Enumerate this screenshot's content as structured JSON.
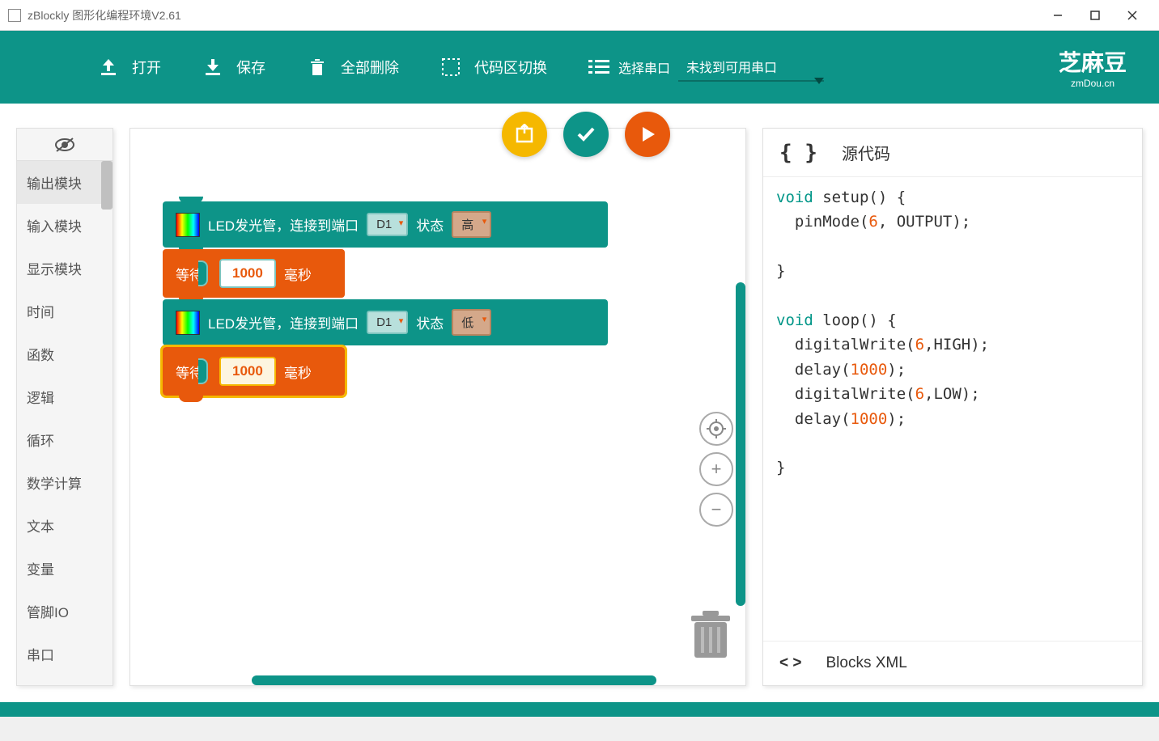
{
  "window": {
    "title": "zBlockly 图形化编程环境V2.61"
  },
  "toolbar": {
    "open": "打开",
    "save": "保存",
    "deleteAll": "全部删除",
    "toggleCode": "代码区切换",
    "selectPort": "选择串口",
    "portStatus": "未找到可用串口",
    "logoTop": "芝麻豆",
    "logoSub": "zmDou.cn"
  },
  "sidebar": {
    "items": [
      "输出模块",
      "输入模块",
      "显示模块",
      "时间",
      "函数",
      "逻辑",
      "循环",
      "数学计算",
      "文本",
      "变量",
      "管脚IO",
      "串口"
    ]
  },
  "blocks": {
    "led": {
      "label": "LED发光管，连接到端口",
      "portLabelD1": "D1",
      "stateLabel": "状态",
      "stateHigh": "高",
      "stateLow": "低"
    },
    "wait": {
      "label": "等待",
      "value1": "1000",
      "value2": "1000",
      "unit": "毫秒"
    }
  },
  "codePanel": {
    "title": "源代码",
    "footer": "Blocks XML",
    "code": {
      "l1a": "void",
      "l1b": " setup() {",
      "l2a": "  pinMode(",
      "l2b": "6",
      "l2c": ", OUTPUT);",
      "l3": "}",
      "l4a": "void",
      "l4b": " loop() {",
      "l5a": "  digitalWrite(",
      "l5b": "6",
      "l5c": ",HIGH);",
      "l6a": "  delay(",
      "l6b": "1000",
      "l6c": ");",
      "l7a": "  digitalWrite(",
      "l7b": "6",
      "l7c": ",LOW);",
      "l8a": "  delay(",
      "l8b": "1000",
      "l8c": ");",
      "l9": "}"
    }
  }
}
